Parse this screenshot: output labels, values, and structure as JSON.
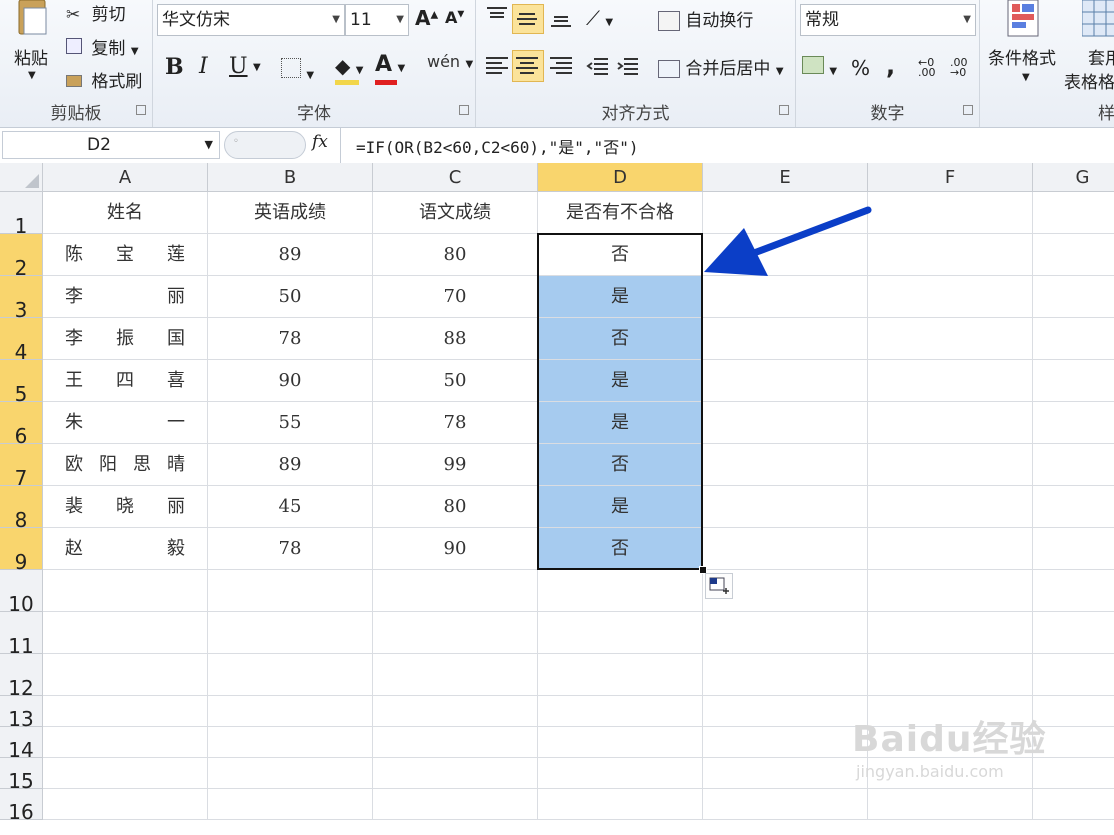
{
  "ribbon": {
    "clipboard": {
      "group_label": "剪贴板",
      "paste": "粘贴",
      "cut": "剪切",
      "copy": "复制",
      "format_painter": "格式刷"
    },
    "font": {
      "group_label": "字体",
      "font_name": "华文仿宋",
      "font_size": "11",
      "bold": "B",
      "italic": "I",
      "underline": "U",
      "font_color_glyph": "A"
    },
    "alignment": {
      "group_label": "对齐方式",
      "wrap_text": "自动换行",
      "merge_center": "合并后居中"
    },
    "number": {
      "group_label": "数字",
      "format": "常规",
      "percent": "%",
      "comma": ","
    },
    "styles": {
      "conditional_format": "条件格式",
      "table_format_top": "套用",
      "table_format_bottom": "表格格",
      "group_label_partial": "样"
    }
  },
  "formula_bar": {
    "name_box": "D2",
    "fx": "fx",
    "formula": "=IF(OR(B2<60,C2<60),\"是\",\"否\")"
  },
  "columns": [
    "A",
    "B",
    "C",
    "D",
    "E",
    "F",
    "G"
  ],
  "rows": [
    "1",
    "2",
    "3",
    "4",
    "5",
    "6",
    "7",
    "8",
    "9",
    "10",
    "11",
    "12",
    "13",
    "14",
    "15",
    "16"
  ],
  "headers": [
    "姓名",
    "英语成绩",
    "语文成绩",
    "是否有不合格"
  ],
  "records": [
    {
      "name": "陈 宝 莲",
      "english": "89",
      "chinese": "80",
      "fail": "否"
    },
    {
      "name": "李 丽",
      "english": "50",
      "chinese": "70",
      "fail": "是"
    },
    {
      "name": "李 振 国",
      "english": "78",
      "chinese": "88",
      "fail": "否"
    },
    {
      "name": "王 四 喜",
      "english": "90",
      "chinese": "50",
      "fail": "是"
    },
    {
      "name": "朱 一",
      "english": "55",
      "chinese": "78",
      "fail": "是"
    },
    {
      "name": "欧 阳 思 晴",
      "english": "89",
      "chinese": "99",
      "fail": "否"
    },
    {
      "name": "裴 晓 丽",
      "english": "45",
      "chinese": "80",
      "fail": "是"
    },
    {
      "name": "赵 毅",
      "english": "78",
      "chinese": "90",
      "fail": "否"
    }
  ],
  "colors": {
    "selection": "#a6cbef",
    "header_highlight": "#f9d56d",
    "arrow": "#0b3ec7"
  },
  "watermark": {
    "brand": "Baidu经验",
    "url": "jingyan.baidu.com"
  }
}
